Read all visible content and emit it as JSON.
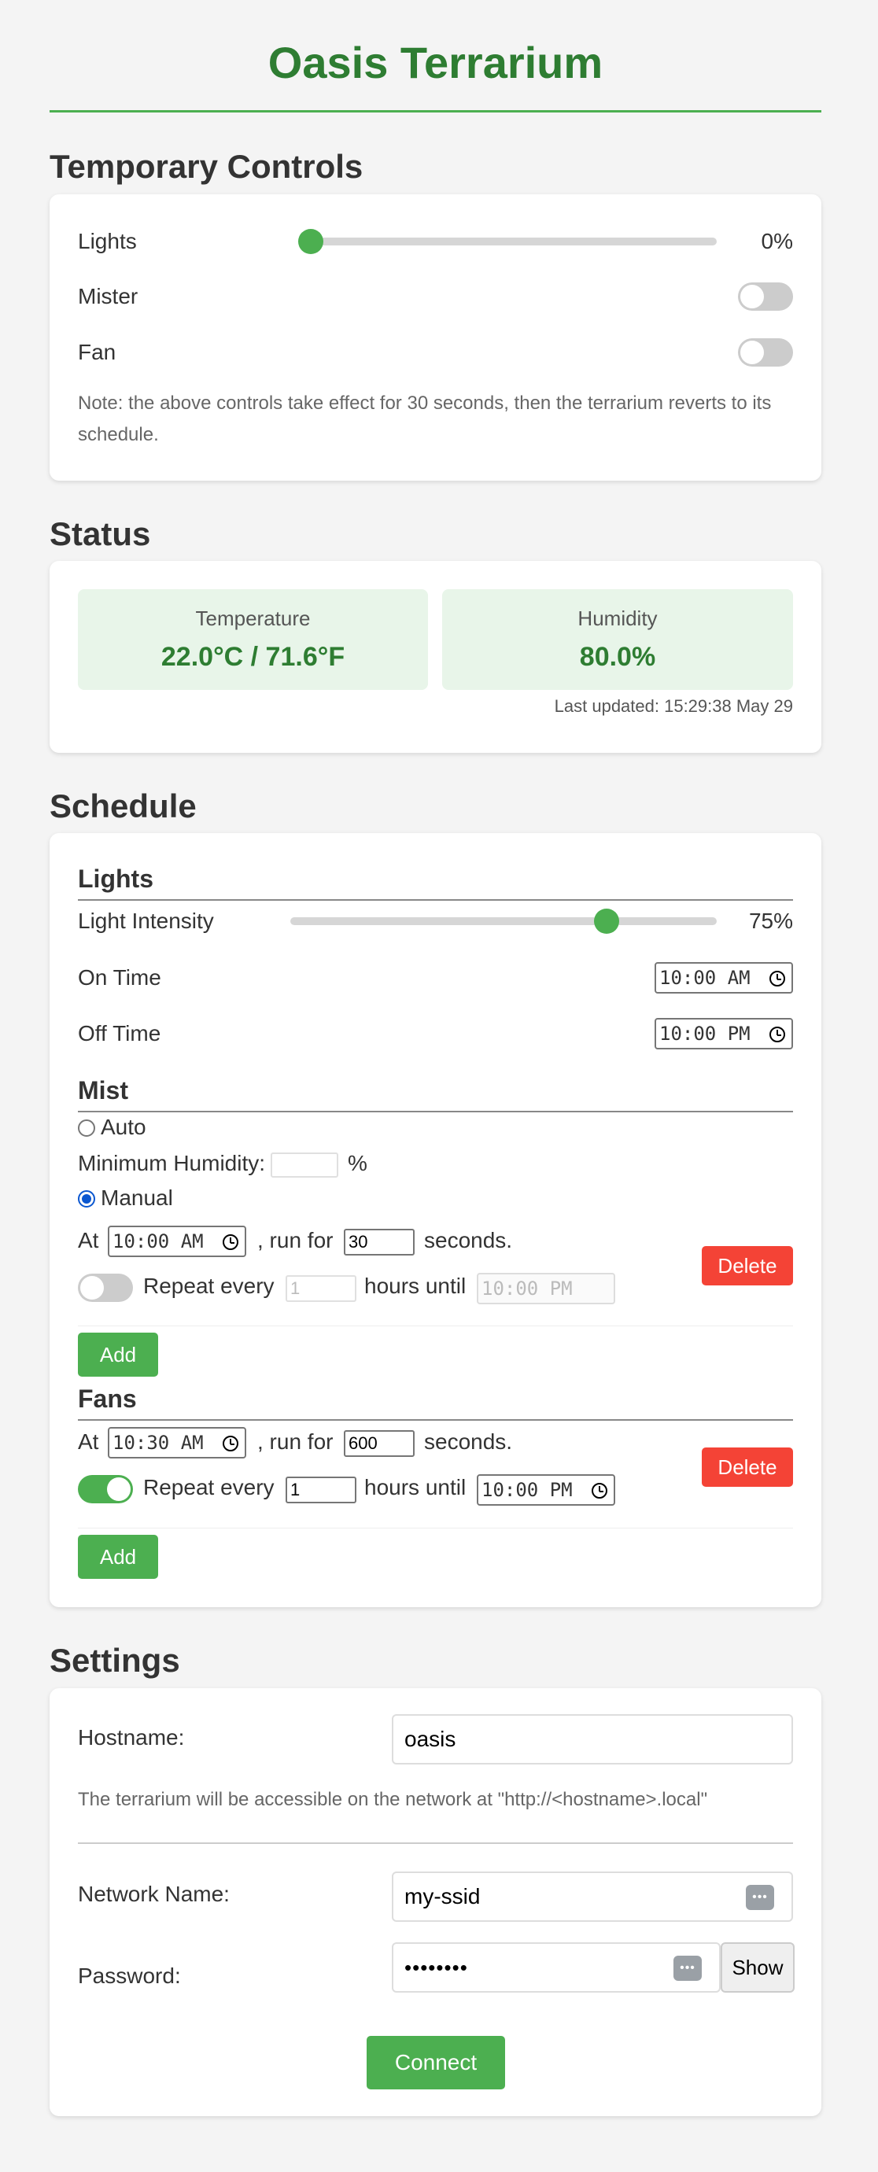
{
  "app": {
    "title": "Oasis Terrarium"
  },
  "temporary_controls": {
    "heading": "Temporary Controls",
    "lights_label": "Lights",
    "lights_value": "0%",
    "lights_level": 0,
    "mister_label": "Mister",
    "mister_on": false,
    "fan_label": "Fan",
    "fan_on": false,
    "note": "Note: the above controls take effect for 30 seconds, then the terrarium reverts to its schedule."
  },
  "status": {
    "heading": "Status",
    "temperature_label": "Temperature",
    "temperature_value": "22.0°C / 71.6°F",
    "humidity_label": "Humidity",
    "humidity_value": "80.0%",
    "last_updated": "Last updated: 15:29:38 May 29"
  },
  "schedule": {
    "heading": "Schedule",
    "lights": {
      "heading": "Lights",
      "intensity_label": "Light Intensity",
      "intensity_value": "75%",
      "intensity_level": 0.75,
      "on_time_label": "On Time",
      "on_time": "10:00 AM",
      "off_time_label": "Off Time",
      "off_time": "10:00 PM"
    },
    "mist": {
      "heading": "Mist",
      "auto_label": "Auto",
      "min_humidity_label": "Minimum Humidity:",
      "min_humidity_unit": "%",
      "manual_label": "Manual",
      "mode": "manual",
      "entries": [
        {
          "at_label": "At",
          "time": "10:00 AM",
          "run_for_label": ", run for",
          "duration": "30",
          "seconds_label": "seconds.",
          "repeat_on": false,
          "repeat_label": "Repeat every",
          "repeat_hours": "1",
          "hours_until_label": "hours until",
          "until_time": "10:00 PM",
          "delete_label": "Delete"
        }
      ],
      "add_label": "Add"
    },
    "fans": {
      "heading": "Fans",
      "entries": [
        {
          "at_label": "At",
          "time": "10:30 AM",
          "run_for_label": ", run for",
          "duration": "600",
          "seconds_label": "seconds.",
          "repeat_on": true,
          "repeat_label": "Repeat every",
          "repeat_hours": "1",
          "hours_until_label": "hours until",
          "until_time": "10:00 PM",
          "delete_label": "Delete"
        }
      ],
      "add_label": "Add"
    }
  },
  "settings": {
    "heading": "Settings",
    "hostname_label": "Hostname:",
    "hostname_value": "oasis",
    "hostname_note": "The terrarium will be accessible on the network at \"http://<hostname>.local\"",
    "network_label": "Network Name:",
    "network_value": "my-ssid",
    "password_label": "Password:",
    "password_value": "••••••••",
    "show_label": "Show",
    "connect_label": "Connect"
  },
  "icons": {
    "clock": "clock-icon",
    "password_manager": "password-manager-icon"
  },
  "colors": {
    "accent": "#4caf50",
    "title": "#2e7d32",
    "danger": "#f44336",
    "status_bg": "#e8f5e9"
  }
}
